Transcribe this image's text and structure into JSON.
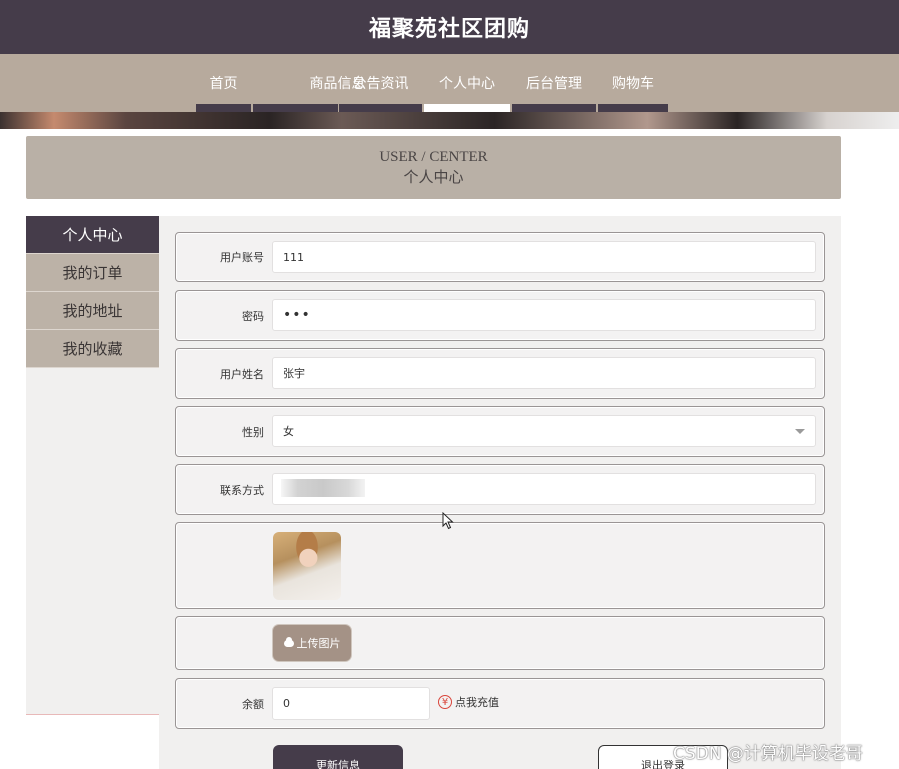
{
  "header": {
    "title": "福聚苑社区团购"
  },
  "nav": {
    "items": [
      {
        "label": "首页"
      },
      {
        "label": "商品信息"
      },
      {
        "label": "公告资讯"
      },
      {
        "label": "个人中心"
      },
      {
        "label": "后台管理"
      },
      {
        "label": "购物车"
      }
    ],
    "active": "个人中心"
  },
  "page_heading": {
    "en": "USER / CENTER",
    "zh": "个人中心"
  },
  "sidebar": {
    "items": [
      {
        "label": "个人中心"
      },
      {
        "label": "我的订单"
      },
      {
        "label": "我的地址"
      },
      {
        "label": "我的收藏"
      }
    ]
  },
  "form": {
    "username": {
      "label": "用户账号",
      "value": "111"
    },
    "password": {
      "label": "密码",
      "value": "•••"
    },
    "realname": {
      "label": "用户姓名",
      "value": "张宇"
    },
    "gender": {
      "label": "性别",
      "value": "女"
    },
    "contact": {
      "label": "联系方式"
    },
    "upload": {
      "label": "上传图片"
    },
    "balance": {
      "label": "余额",
      "value": "0",
      "recharge_label": "点我充值"
    }
  },
  "buttons": {
    "update": "更新信息",
    "logout": "退出登录"
  },
  "watermark": "CSDN @计算机毕设老哥",
  "colors": {
    "header": "#453c4a",
    "nav": "#b7aa9d",
    "accent": "#453c4a",
    "recharge_icon": "#d9453b"
  }
}
